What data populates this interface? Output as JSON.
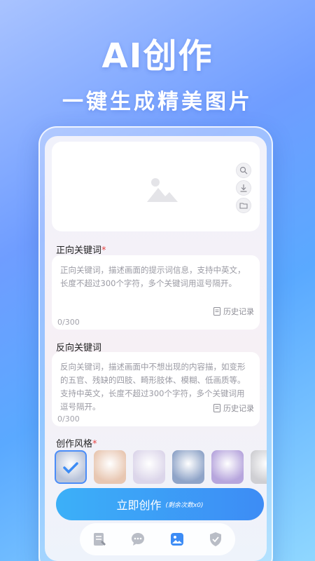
{
  "hero": {
    "title": "AI创作",
    "subtitle": "一键生成精美图片"
  },
  "preview": {
    "placeholder_icon": "image-icon",
    "actions": [
      "zoom-icon",
      "download-icon",
      "folder-icon"
    ]
  },
  "positive": {
    "label": "正向关键词",
    "required_mark": "*",
    "placeholder": "正向关键词，描述画面的提示词信息，支持中英文，长度不超过300个字符，多个关键词用逗号隔开。",
    "counter": "0/300",
    "history_label": "历史记录"
  },
  "negative": {
    "label": "反向关键词",
    "placeholder": "反向关键词，描述画面中不想出现的内容描，如变形的五官、残缺的四肢、畸形肢体、模糊、低画质等。支持中英文，长度不超过300个字符，多个关键词用逗号隔开。",
    "counter": "0/300",
    "history_label": "历史记录"
  },
  "styles": {
    "label": "创作风格",
    "required_mark": "*",
    "items": [
      {
        "name": "style-1",
        "color": "#b9c4da",
        "selected": true
      },
      {
        "name": "style-2",
        "color": "#e8c7b2",
        "selected": false
      },
      {
        "name": "style-3",
        "color": "#dcd6ea",
        "selected": false
      },
      {
        "name": "style-4",
        "color": "#8fa4c8",
        "selected": false
      },
      {
        "name": "style-5",
        "color": "#b7a6dd",
        "selected": false
      },
      {
        "name": "style-6",
        "color": "#cfcfd3",
        "selected": false
      }
    ]
  },
  "action": {
    "create_label": "立即创作",
    "remaining": "(剩余次数x0)"
  },
  "bottom_nav": [
    "notes-icon",
    "chat-icon",
    "gallery-icon",
    "shield-icon"
  ],
  "colors": {
    "accent": "#3d8cf5",
    "required": "#e64545"
  }
}
